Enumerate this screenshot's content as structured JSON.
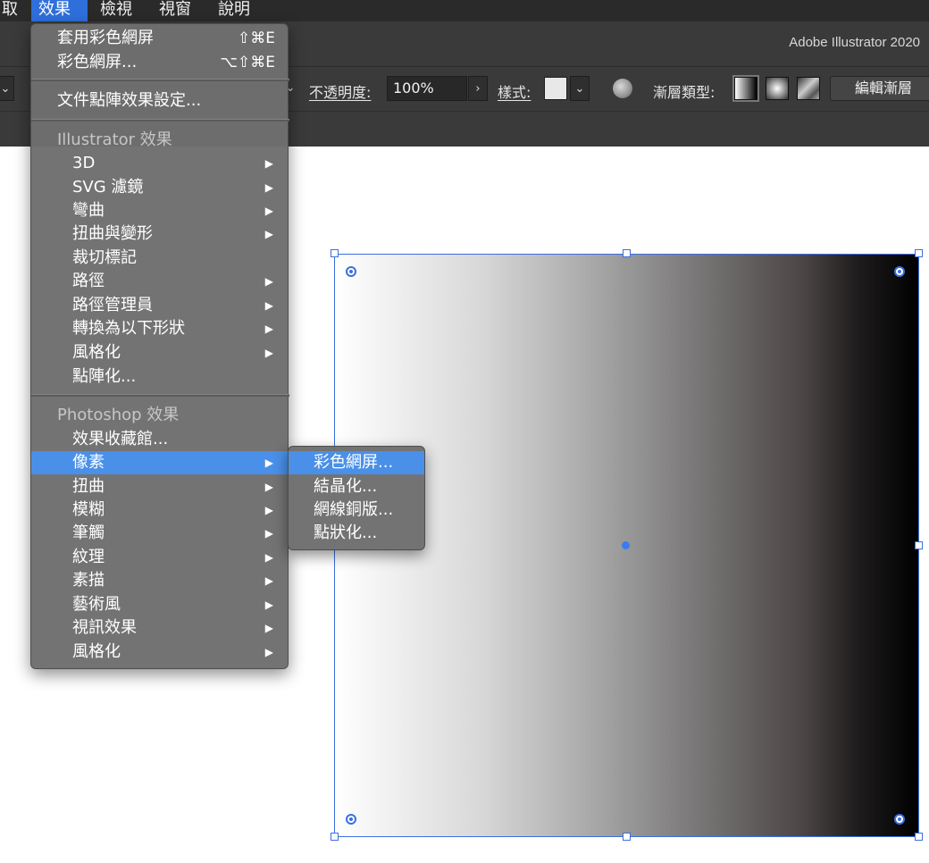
{
  "menubar": {
    "items": [
      "取",
      "效果",
      "檢視",
      "視窗",
      "說明"
    ],
    "active": "效果"
  },
  "app_title": "Adobe Illustrator 2020",
  "control_bar": {
    "opacity_label": "不透明度:",
    "opacity_value": "100%",
    "style_label": "樣式:",
    "gradient_type_label": "漸層類型:",
    "edit_gradient_label": "編輯漸層"
  },
  "effect_menu": {
    "apply_last": {
      "label": "套用彩色網屏",
      "shortcut": "⇧⌘E"
    },
    "last_effect": {
      "label": "彩色網屏...",
      "shortcut": "⌥⇧⌘E"
    },
    "document_raster": "文件點陣效果設定...",
    "illustrator_header": "Illustrator 效果",
    "illustrator_items": [
      {
        "label": "3D",
        "submenu": true
      },
      {
        "label": "SVG 濾鏡",
        "submenu": true
      },
      {
        "label": "彎曲",
        "submenu": true
      },
      {
        "label": "扭曲與變形",
        "submenu": true
      },
      {
        "label": "裁切標記",
        "submenu": false
      },
      {
        "label": "路徑",
        "submenu": true
      },
      {
        "label": "路徑管理員",
        "submenu": true
      },
      {
        "label": "轉換為以下形狀",
        "submenu": true
      },
      {
        "label": "風格化",
        "submenu": true
      },
      {
        "label": "點陣化...",
        "submenu": false
      }
    ],
    "photoshop_header": "Photoshop 效果",
    "photoshop_items": [
      {
        "label": "效果收藏館...",
        "submenu": false
      },
      {
        "label": "像素",
        "submenu": true,
        "highlighted": true
      },
      {
        "label": "扭曲",
        "submenu": true
      },
      {
        "label": "模糊",
        "submenu": true
      },
      {
        "label": "筆觸",
        "submenu": true
      },
      {
        "label": "紋理",
        "submenu": true
      },
      {
        "label": "素描",
        "submenu": true
      },
      {
        "label": "藝術風",
        "submenu": true
      },
      {
        "label": "視訊效果",
        "submenu": true
      },
      {
        "label": "風格化",
        "submenu": true
      }
    ]
  },
  "pixelate_submenu": {
    "items": [
      "彩色網屏...",
      "結晶化...",
      "網線銅版...",
      "點狀化..."
    ],
    "highlighted": "彩色網屏..."
  },
  "colors": {
    "highlight": "#4a90e8",
    "selection": "#3b6fe0"
  }
}
